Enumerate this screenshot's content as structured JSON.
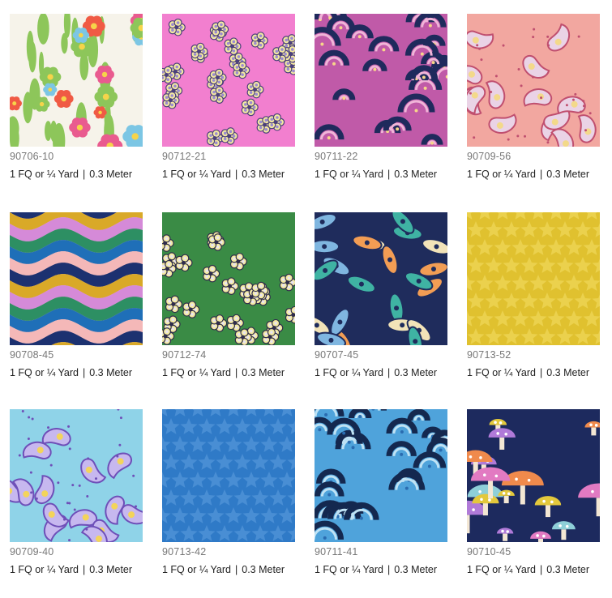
{
  "products": [
    {
      "sku": "90706-10",
      "unit": "1 FQ or ¼ Yard",
      "metric": "0.3 Meter",
      "pattern": "floral-bouquet",
      "colors": [
        "#f6f3ea",
        "#e95b8f",
        "#f05a44",
        "#7cc6e4",
        "#8dc65a",
        "#b484d6"
      ]
    },
    {
      "sku": "90712-21",
      "unit": "1 FQ or ¼ Yard",
      "metric": "0.3 Meter",
      "pattern": "ditsy-flowers",
      "colors": [
        "#f27fcf",
        "#4a3f7c",
        "#f4e9a0",
        "#9a8bd0"
      ]
    },
    {
      "sku": "90711-22",
      "unit": "1 FQ or ¼ Yard",
      "metric": "0.3 Meter",
      "pattern": "wave-clouds",
      "colors": [
        "#c05aa8",
        "#1f2a5c",
        "#f0b5d8",
        "#f7d68a"
      ]
    },
    {
      "sku": "90709-56",
      "unit": "1 FQ or ¼ Yard",
      "metric": "0.3 Meter",
      "pattern": "paisley",
      "colors": [
        "#f2a7a0",
        "#c04f6f",
        "#f3d98a",
        "#ead3e6"
      ]
    },
    {
      "sku": "90708-45",
      "unit": "1 FQ or ¼ Yard",
      "metric": "0.3 Meter",
      "pattern": "wavy-stripes",
      "colors": [
        "#f4b8b8",
        "#1c3170",
        "#d9a928",
        "#d58ad8",
        "#2d8f63",
        "#1f6fb8"
      ]
    },
    {
      "sku": "90712-74",
      "unit": "1 FQ or ¼ Yard",
      "metric": "0.3 Meter",
      "pattern": "ditsy-flowers",
      "colors": [
        "#3a8b45",
        "#2f2c4c",
        "#f4eaa0",
        "#e9e4f0"
      ]
    },
    {
      "sku": "90707-45",
      "unit": "1 FQ or ¼ Yard",
      "metric": "0.3 Meter",
      "pattern": "butterfly-wings",
      "colors": [
        "#1f2c5c",
        "#3fb3a3",
        "#f29d54",
        "#f2e3b8",
        "#7fb6e0"
      ]
    },
    {
      "sku": "90713-52",
      "unit": "1 FQ or ¼ Yard",
      "metric": "0.3 Meter",
      "pattern": "stars",
      "colors": [
        "#e0c12f",
        "#ecd352"
      ]
    },
    {
      "sku": "90709-40",
      "unit": "1 FQ or ¼ Yard",
      "metric": "0.3 Meter",
      "pattern": "paisley",
      "colors": [
        "#8fd3e8",
        "#6e4fb8",
        "#f3d45a",
        "#c7b8ef"
      ]
    },
    {
      "sku": "90713-42",
      "unit": "1 FQ or ¼ Yard",
      "metric": "0.3 Meter",
      "pattern": "stars",
      "colors": [
        "#2f7ac7",
        "#4e92d6"
      ]
    },
    {
      "sku": "90711-41",
      "unit": "1 FQ or ¼ Yard",
      "metric": "0.3 Meter",
      "pattern": "wave-clouds",
      "colors": [
        "#4fa3db",
        "#14284f",
        "#bfe2f4",
        "#2a6cb0"
      ]
    },
    {
      "sku": "90710-45",
      "unit": "1 FQ or ¼ Yard",
      "metric": "0.3 Meter",
      "pattern": "mushrooms",
      "colors": [
        "#1d2a5e",
        "#e3c83c",
        "#e27ac2",
        "#f08a4c",
        "#8ecfd8",
        "#b07ad8"
      ]
    }
  ]
}
